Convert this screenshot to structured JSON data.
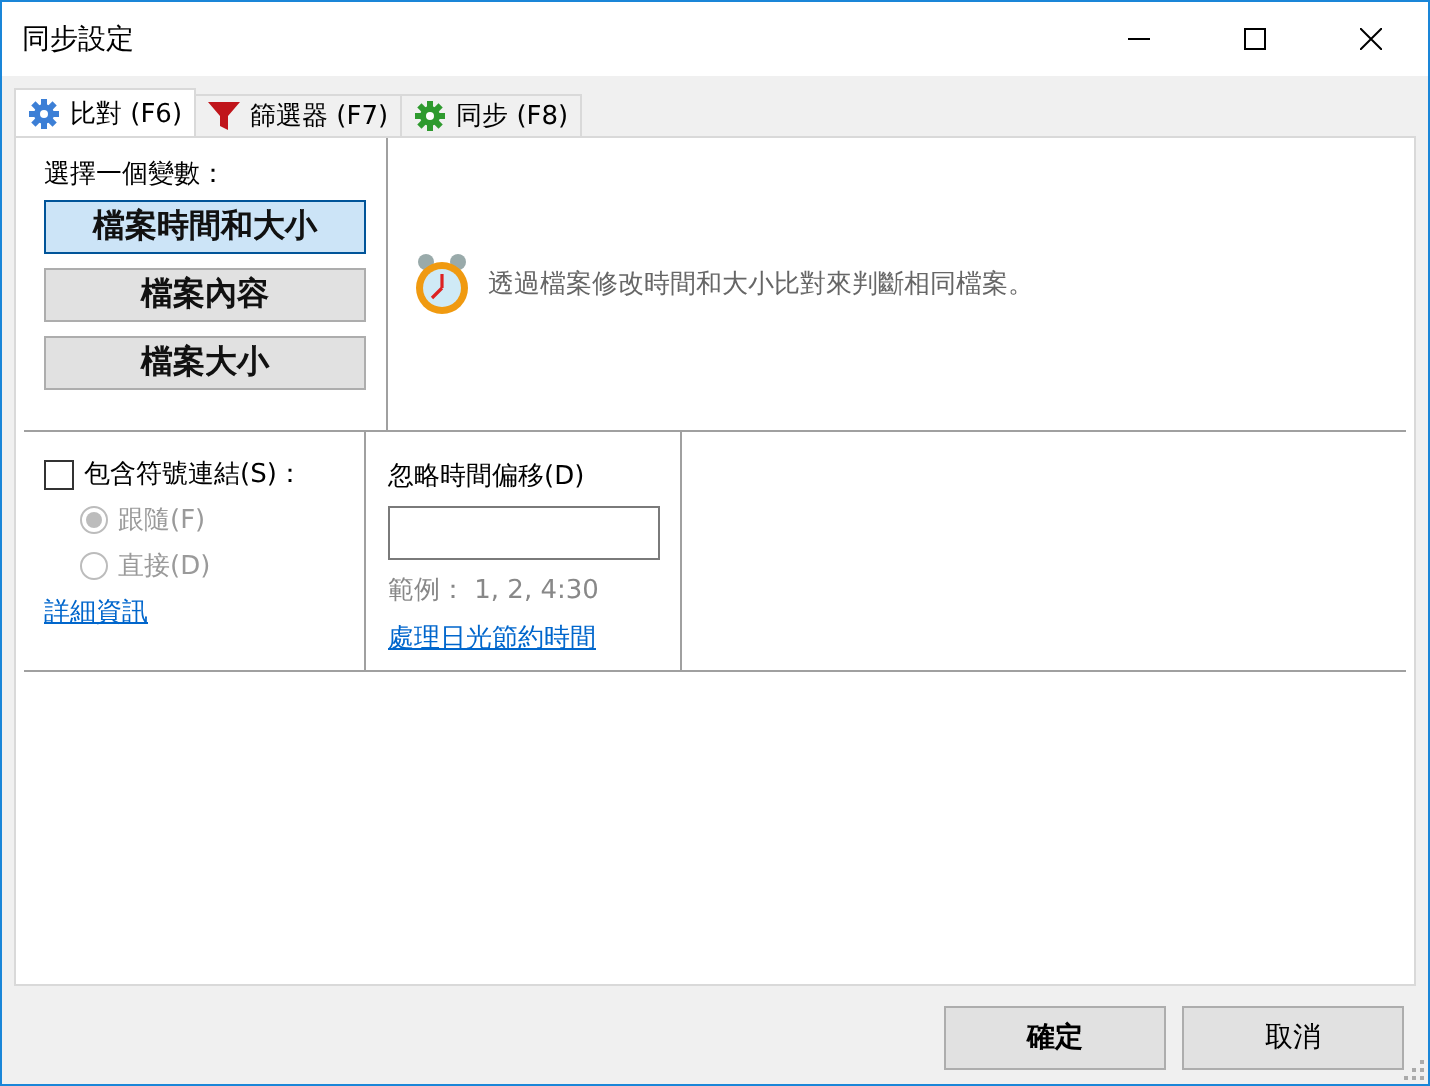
{
  "window": {
    "title": "同步設定"
  },
  "tabs": [
    {
      "label": "比對 (F6)",
      "selected": true
    },
    {
      "label": "篩選器 (F7)",
      "selected": false
    },
    {
      "label": "同步 (F8)",
      "selected": false
    }
  ],
  "variant": {
    "label": "選擇一個變數：",
    "options": [
      {
        "label": "檔案時間和大小",
        "selected": true
      },
      {
        "label": "檔案內容",
        "selected": false
      },
      {
        "label": "檔案大小",
        "selected": false
      }
    ],
    "description": "透過檔案修改時間和大小比對來判斷相同檔案。"
  },
  "symlinks": {
    "label": "包含符號連結(S)：",
    "checked": false,
    "options": [
      {
        "label": "跟隨(F)",
        "selected": true,
        "disabled": true
      },
      {
        "label": "直接(D)",
        "selected": false,
        "disabled": true
      }
    ],
    "link": "詳細資訊"
  },
  "time_shift": {
    "label": "忽略時間偏移(D)",
    "example": "範例： 1, 2, 4:30",
    "link": "處理日光節約時間"
  },
  "buttons": [
    {
      "label": "確定",
      "default": true
    },
    {
      "label": "取消",
      "default": false
    }
  ]
}
